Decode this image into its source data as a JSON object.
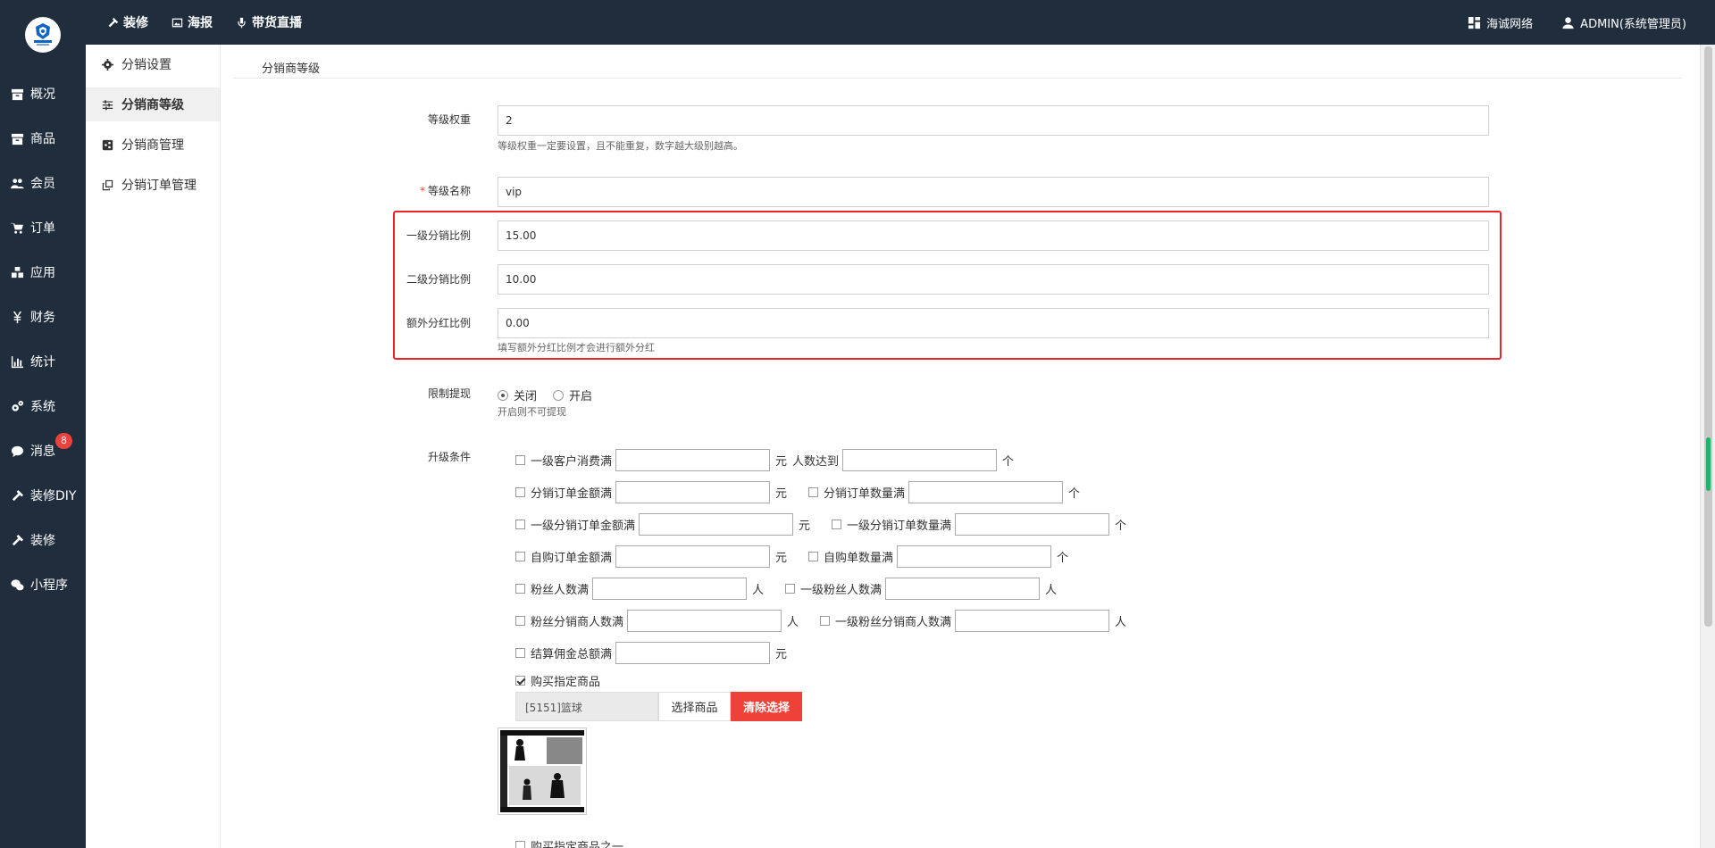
{
  "topnav": {
    "items": [
      {
        "label": "装修",
        "icon": "hammer-icon"
      },
      {
        "label": "海报",
        "icon": "image-icon"
      },
      {
        "label": "带货直播",
        "icon": "microphone-icon"
      }
    ],
    "company": "海诚网络",
    "user": "ADMIN(系统管理员)"
  },
  "sidebar": {
    "items": [
      {
        "label": "概况",
        "icon": "archive-icon"
      },
      {
        "label": "商品",
        "icon": "box-icon"
      },
      {
        "label": "会员",
        "icon": "users-icon"
      },
      {
        "label": "订单",
        "icon": "cart-icon"
      },
      {
        "label": "应用",
        "icon": "cubes-icon"
      },
      {
        "label": "财务",
        "icon": "yen-icon"
      },
      {
        "label": "统计",
        "icon": "bar-chart-icon"
      },
      {
        "label": "系统",
        "icon": "gears-icon"
      },
      {
        "label": "消息",
        "icon": "comment-icon",
        "badge": "8"
      },
      {
        "label": "装修DIY",
        "icon": "hammer-icon"
      },
      {
        "label": "装修",
        "icon": "hammer-icon"
      },
      {
        "label": "小程序",
        "icon": "wechat-icon"
      }
    ]
  },
  "subnav": {
    "items": [
      {
        "label": "分销设置",
        "icon": "gear-icon",
        "active": false
      },
      {
        "label": "分销商等级",
        "icon": "sliders-icon",
        "active": true
      },
      {
        "label": "分销商管理",
        "icon": "share-icon",
        "active": false
      },
      {
        "label": "分销订单管理",
        "icon": "copy-icon",
        "active": false
      }
    ]
  },
  "page": {
    "section_title": "分销商等级",
    "weight_label": "等级权重",
    "weight_value": "2",
    "weight_help": "等级权重一定要设置，且不能重复，数字越大级别越高。",
    "name_required": "*",
    "name_label": "等级名称",
    "name_value": "vip",
    "level1_label": "一级分销比例",
    "level1_value": "15.00",
    "level2_label": "二级分销比例",
    "level2_value": "10.00",
    "bonus_label": "额外分红比例",
    "bonus_value": "0.00",
    "bonus_help": "填写额外分红比例才会进行额外分红",
    "limit_label": "限制提现",
    "limit_off": "关闭",
    "limit_on": "开启",
    "limit_help": "开启则不可提现",
    "upgrade_label": "升级条件",
    "cond": {
      "c1": "一级客户消费满",
      "c1_unit": "元",
      "c1b": "人数达到",
      "c1b_unit": "个",
      "c2": "分销订单金额满",
      "c2_unit": "元",
      "c2b": "分销订单数量满",
      "c2b_unit": "个",
      "c3": "一级分销订单金额满",
      "c3_unit": "元",
      "c3b": "一级分销订单数量满",
      "c3b_unit": "个",
      "c4": "自购订单金额满",
      "c4_unit": "元",
      "c4b": "自购单数量满",
      "c4b_unit": "个",
      "c5": "粉丝人数满",
      "c5_unit": "人",
      "c5b": "一级粉丝人数满",
      "c5b_unit": "人",
      "c6": "粉丝分销商人数满",
      "c6_unit": "人",
      "c6b": "一级粉丝分销商人数满",
      "c6b_unit": "人",
      "c7": "结算佣金总额满",
      "c7_unit": "元",
      "c8": "购买指定商品",
      "c9": "购买指定商品之一"
    },
    "goods_value": "[5151]篮球",
    "select_goods": "选择商品",
    "clear_select": "清除选择"
  },
  "colors": {
    "dark_nav": "#1f2d3d",
    "highlight_border": "#e9242a",
    "clear_button": "#ee4137",
    "badge": "#e9433c"
  }
}
